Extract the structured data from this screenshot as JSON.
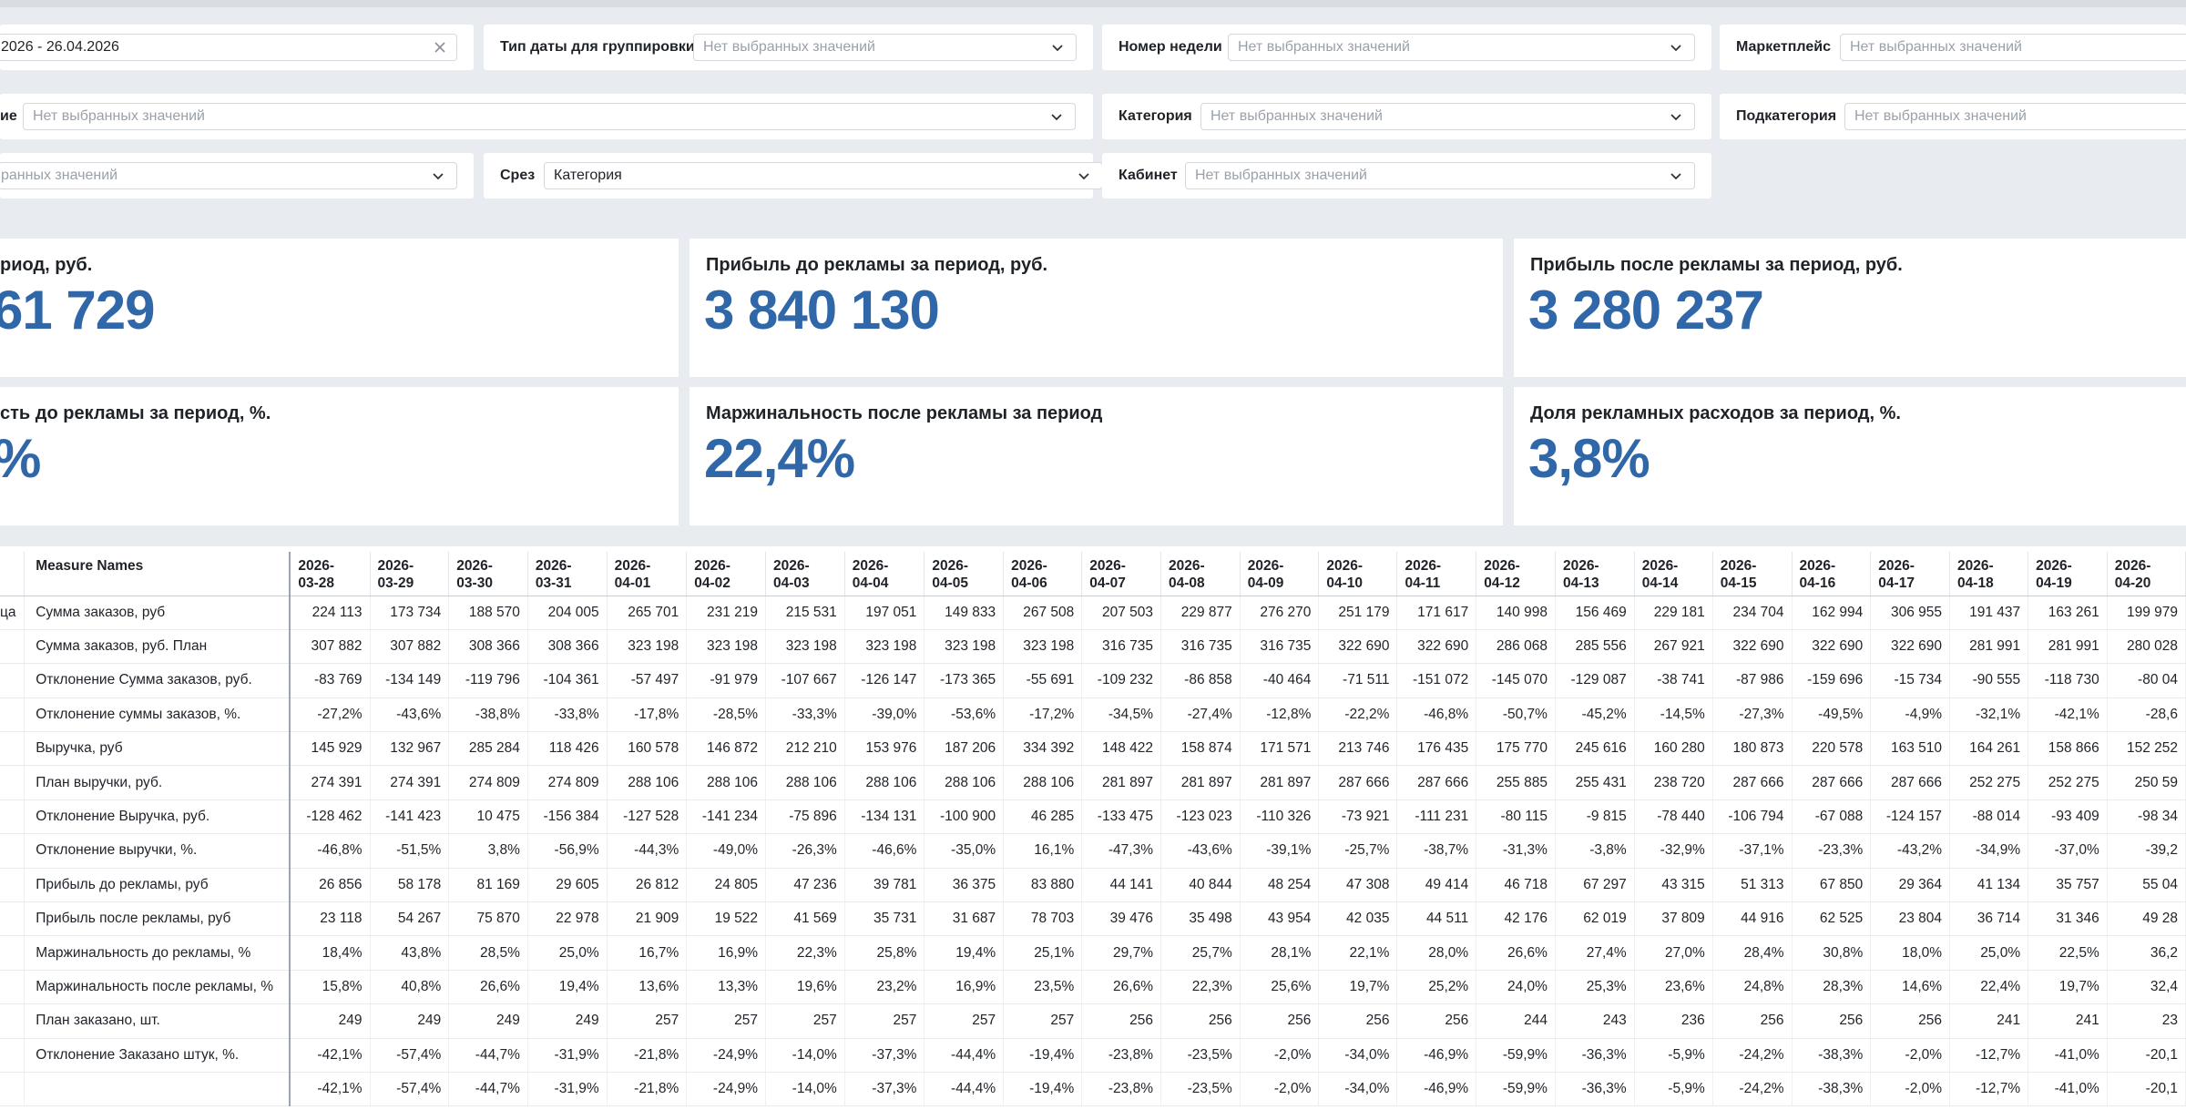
{
  "filters": {
    "period_value": "2026 - 26.04.2026",
    "date_type_label": "Тип даты для группировки",
    "placeholder": "Нет выбранных значений",
    "week_label": "Номер недели",
    "marketplace_label": "Маркетплейс",
    "row2_left_label": "ие",
    "category_label": "Категория",
    "subcategory_label": "Подкатегория",
    "row3_left_placeholder": "ранных значений",
    "slice_label": "Срез",
    "slice_value": "Категория",
    "cabinet_label": "Кабинет"
  },
  "kpis": {
    "k1_title": "риод, руб.",
    "k1_value": "61 729",
    "k2_title": "Прибыль до рекламы за период, руб.",
    "k2_value": "3 840 130",
    "k3_title": "Прибыль после рекламы за период, руб.",
    "k3_value": "3 280 237",
    "k4_title": "сть до рекламы за период, %.",
    "k4_value": "%",
    "k5_title": "Маржинальность после рекламы за период",
    "k5_value": "22,4%",
    "k6_title": "Доля рекламных расходов за период, %.",
    "k6_value": "3,8%"
  },
  "table": {
    "measure_header": "Measure Names",
    "first_col_cell": "ца",
    "dates": [
      [
        "2026-",
        "03-28"
      ],
      [
        "2026-",
        "03-29"
      ],
      [
        "2026-",
        "03-30"
      ],
      [
        "2026-",
        "03-31"
      ],
      [
        "2026-",
        "04-01"
      ],
      [
        "2026-",
        "04-02"
      ],
      [
        "2026-",
        "04-03"
      ],
      [
        "2026-",
        "04-04"
      ],
      [
        "2026-",
        "04-05"
      ],
      [
        "2026-",
        "04-06"
      ],
      [
        "2026-",
        "04-07"
      ],
      [
        "2026-",
        "04-08"
      ],
      [
        "2026-",
        "04-09"
      ],
      [
        "2026-",
        "04-10"
      ],
      [
        "2026-",
        "04-11"
      ],
      [
        "2026-",
        "04-12"
      ],
      [
        "2026-",
        "04-13"
      ],
      [
        "2026-",
        "04-14"
      ],
      [
        "2026-",
        "04-15"
      ],
      [
        "2026-",
        "04-16"
      ],
      [
        "2026-",
        "04-17"
      ],
      [
        "2026-",
        "04-18"
      ],
      [
        "2026-",
        "04-19"
      ],
      [
        "2026-",
        "04-20"
      ]
    ],
    "rows": [
      {
        "name": "Сумма заказов, руб",
        "values": [
          "224 113",
          "173 734",
          "188 570",
          "204 005",
          "265 701",
          "231 219",
          "215 531",
          "197 051",
          "149 833",
          "267 508",
          "207 503",
          "229 877",
          "276 270",
          "251 179",
          "171 617",
          "140 998",
          "156 469",
          "229 181",
          "234 704",
          "162 994",
          "306 955",
          "191 437",
          "163 261",
          "199 979"
        ]
      },
      {
        "name": "Сумма заказов, руб. План",
        "values": [
          "307 882",
          "307 882",
          "308 366",
          "308 366",
          "323 198",
          "323 198",
          "323 198",
          "323 198",
          "323 198",
          "323 198",
          "316 735",
          "316 735",
          "316 735",
          "322 690",
          "322 690",
          "286 068",
          "285 556",
          "267 921",
          "322 690",
          "322 690",
          "322 690",
          "281 991",
          "281 991",
          "280 028"
        ]
      },
      {
        "name": "Отклонение Сумма заказов, руб.",
        "values": [
          "-83 769",
          "-134 149",
          "-119 796",
          "-104 361",
          "-57 497",
          "-91 979",
          "-107 667",
          "-126 147",
          "-173 365",
          "-55 691",
          "-109 232",
          "-86 858",
          "-40 464",
          "-71 511",
          "-151 072",
          "-145 070",
          "-129 087",
          "-38 741",
          "-87 986",
          "-159 696",
          "-15 734",
          "-90 555",
          "-118 730",
          "-80 04"
        ]
      },
      {
        "name": "Отклонение суммы заказов, %.",
        "values": [
          "-27,2%",
          "-43,6%",
          "-38,8%",
          "-33,8%",
          "-17,8%",
          "-28,5%",
          "-33,3%",
          "-39,0%",
          "-53,6%",
          "-17,2%",
          "-34,5%",
          "-27,4%",
          "-12,8%",
          "-22,2%",
          "-46,8%",
          "-50,7%",
          "-45,2%",
          "-14,5%",
          "-27,3%",
          "-49,5%",
          "-4,9%",
          "-32,1%",
          "-42,1%",
          "-28,6"
        ]
      },
      {
        "name": "Выручка, руб",
        "values": [
          "145 929",
          "132 967",
          "285 284",
          "118 426",
          "160 578",
          "146 872",
          "212 210",
          "153 976",
          "187 206",
          "334 392",
          "148 422",
          "158 874",
          "171 571",
          "213 746",
          "176 435",
          "175 770",
          "245 616",
          "160 280",
          "180 873",
          "220 578",
          "163 510",
          "164 261",
          "158 866",
          "152 252"
        ]
      },
      {
        "name": "План выручки, руб.",
        "values": [
          "274 391",
          "274 391",
          "274 809",
          "274 809",
          "288 106",
          "288 106",
          "288 106",
          "288 106",
          "288 106",
          "288 106",
          "281 897",
          "281 897",
          "281 897",
          "287 666",
          "287 666",
          "255 885",
          "255 431",
          "238 720",
          "287 666",
          "287 666",
          "287 666",
          "252 275",
          "252 275",
          "250 59"
        ]
      },
      {
        "name": "Отклонение Выручка, руб.",
        "values": [
          "-128 462",
          "-141 423",
          "10 475",
          "-156 384",
          "-127 528",
          "-141 234",
          "-75 896",
          "-134 131",
          "-100 900",
          "46 285",
          "-133 475",
          "-123 023",
          "-110 326",
          "-73 921",
          "-111 231",
          "-80 115",
          "-9 815",
          "-78 440",
          "-106 794",
          "-67 088",
          "-124 157",
          "-88 014",
          "-93 409",
          "-98 34"
        ]
      },
      {
        "name": "Отклонение выручки, %.",
        "values": [
          "-46,8%",
          "-51,5%",
          "3,8%",
          "-56,9%",
          "-44,3%",
          "-49,0%",
          "-26,3%",
          "-46,6%",
          "-35,0%",
          "16,1%",
          "-47,3%",
          "-43,6%",
          "-39,1%",
          "-25,7%",
          "-38,7%",
          "-31,3%",
          "-3,8%",
          "-32,9%",
          "-37,1%",
          "-23,3%",
          "-43,2%",
          "-34,9%",
          "-37,0%",
          "-39,2"
        ]
      },
      {
        "name": "Прибыль до рекламы, руб",
        "values": [
          "26 856",
          "58 178",
          "81 169",
          "29 605",
          "26 812",
          "24 805",
          "47 236",
          "39 781",
          "36 375",
          "83 880",
          "44 141",
          "40 844",
          "48 254",
          "47 308",
          "49 414",
          "46 718",
          "67 297",
          "43 315",
          "51 313",
          "67 850",
          "29 364",
          "41 134",
          "35 757",
          "55 04"
        ]
      },
      {
        "name": "Прибыль после рекламы, руб",
        "values": [
          "23 118",
          "54 267",
          "75 870",
          "22 978",
          "21 909",
          "19 522",
          "41 569",
          "35 731",
          "31 687",
          "78 703",
          "39 476",
          "35 498",
          "43 954",
          "42 035",
          "44 511",
          "42 176",
          "62 019",
          "37 809",
          "44 916",
          "62 525",
          "23 804",
          "36 714",
          "31 346",
          "49 28"
        ]
      },
      {
        "name": "Маржинальность до рекламы, %",
        "values": [
          "18,4%",
          "43,8%",
          "28,5%",
          "25,0%",
          "16,7%",
          "16,9%",
          "22,3%",
          "25,8%",
          "19,4%",
          "25,1%",
          "29,7%",
          "25,7%",
          "28,1%",
          "22,1%",
          "28,0%",
          "26,6%",
          "27,4%",
          "27,0%",
          "28,4%",
          "30,8%",
          "18,0%",
          "25,0%",
          "22,5%",
          "36,2"
        ]
      },
      {
        "name": "Маржинальность после рекламы, %",
        "values": [
          "15,8%",
          "40,8%",
          "26,6%",
          "19,4%",
          "13,6%",
          "13,3%",
          "19,6%",
          "23,2%",
          "16,9%",
          "23,5%",
          "26,6%",
          "22,3%",
          "25,6%",
          "19,7%",
          "25,2%",
          "24,0%",
          "25,3%",
          "23,6%",
          "24,8%",
          "28,3%",
          "14,6%",
          "22,4%",
          "19,7%",
          "32,4"
        ]
      },
      {
        "name": "План заказано, шт.",
        "values": [
          "249",
          "249",
          "249",
          "249",
          "257",
          "257",
          "257",
          "257",
          "257",
          "257",
          "256",
          "256",
          "256",
          "256",
          "256",
          "244",
          "243",
          "236",
          "256",
          "256",
          "256",
          "241",
          "241",
          "23"
        ]
      },
      {
        "name": "Отклонение Заказано штук, %.",
        "values": [
          "-42,1%",
          "-57,4%",
          "-44,7%",
          "-31,9%",
          "-21,8%",
          "-24,9%",
          "-14,0%",
          "-37,3%",
          "-44,4%",
          "-19,4%",
          "-23,8%",
          "-23,5%",
          "-2,0%",
          "-34,0%",
          "-46,9%",
          "-59,9%",
          "-36,3%",
          "-5,9%",
          "-24,2%",
          "-38,3%",
          "-2,0%",
          "-12,7%",
          "-41,0%",
          "-20,1"
        ]
      },
      {
        "name": "",
        "values": [
          "-42,1%",
          "-57,4%",
          "-44,7%",
          "-31,9%",
          "-21,8%",
          "-24,9%",
          "-14,0%",
          "-37,3%",
          "-44,4%",
          "-19,4%",
          "-23,8%",
          "-23,5%",
          "-2,0%",
          "-34,0%",
          "-46,9%",
          "-59,9%",
          "-36,3%",
          "-5,9%",
          "-24,2%",
          "-38,3%",
          "-2,0%",
          "-12,7%",
          "-41,0%",
          "-20,1"
        ]
      }
    ]
  }
}
